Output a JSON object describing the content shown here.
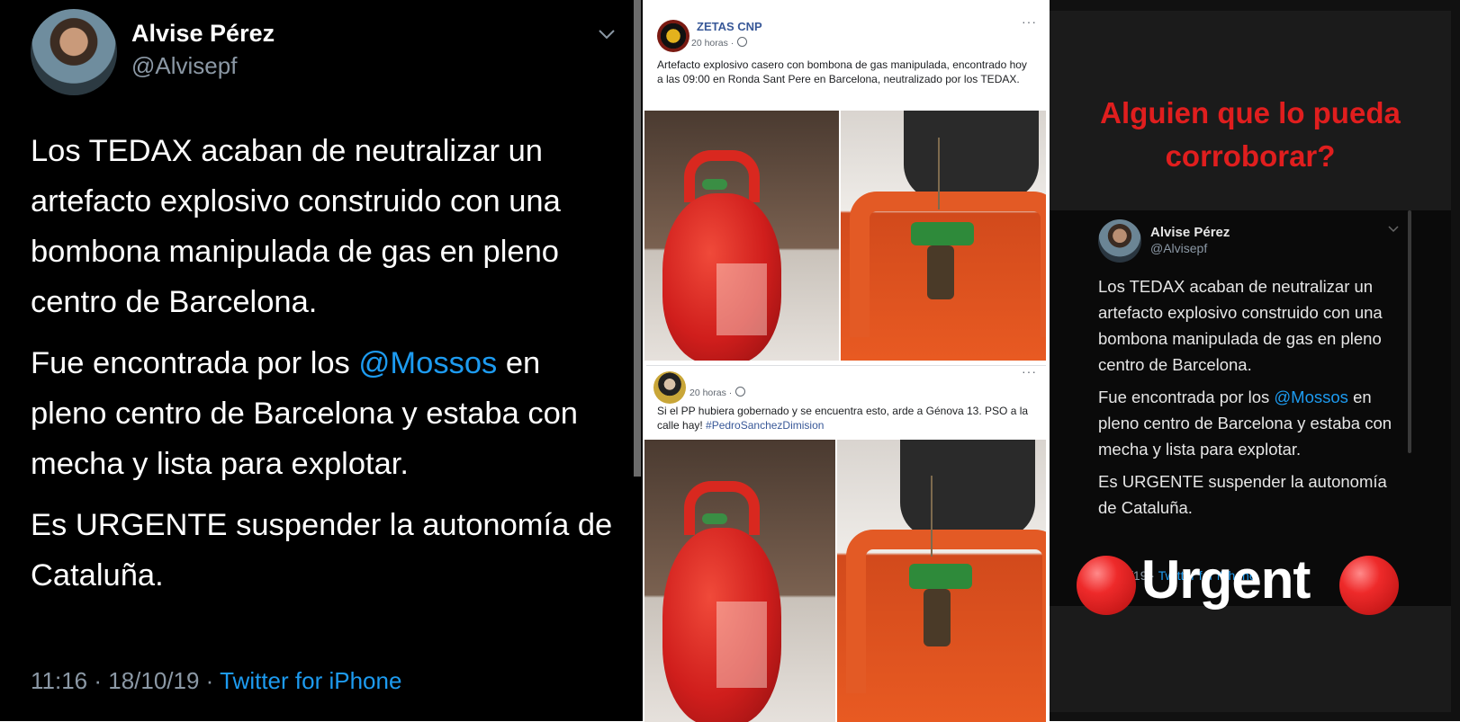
{
  "tweet": {
    "name": "Alvise Pérez",
    "handle": "@Alvisepf",
    "paragraph1": "Los TEDAX acaban de neutralizar un artefacto explosivo construido con una bombona manipulada de gas en pleno centro de Barcelona.",
    "p2_before": "Fue encontrada por los ",
    "p2_mention": "@Mossos",
    "p2_after": " en pleno centro de Barcelona y estaba con mecha y lista para explotar.",
    "paragraph3": "Es URGENTE suspender la autonomía de Cataluña.",
    "timestamp": "11:16 · 18/10/19 · ",
    "source": "Twitter for iPhone",
    "icons": {
      "menu": "chevron-down-icon"
    }
  },
  "facebook": {
    "post1": {
      "page_name": "ZETAS CNP",
      "time": "20 horas ·",
      "menu": "···",
      "text": "Artefacto explosivo casero con bombona de gas manipulada, encontrado hoy a las 09:00 en Ronda Sant Pere en Barcelona, neutralizado por los TEDAX."
    },
    "post2": {
      "time": "20 horas ·",
      "menu": "···",
      "text": "Si el PP hubiera gobernado y se encuentra esto, arde a Génova 13. PSO a la calle hay! ",
      "hashtag": "#PedroSanchezDimision"
    },
    "colors": {
      "link": "#385898",
      "cylinder": "#d01e1c",
      "valve": "#2e8a3a"
    }
  },
  "story": {
    "headline_line1": "Alguien que lo pueda",
    "headline_line2": "corroborar?",
    "name": "Alvise Pérez",
    "handle": "@Alvisepf",
    "paragraph1": "Los TEDAX acaban de neutralizar un artefacto explosivo construido con una bombona manipulada de gas en pleno centro de Barcelona.",
    "p2_before": "Fue encontrada por los ",
    "p2_mention": "@Mossos",
    "p2_after": " en pleno centro de Barcelona y estaba con mecha y lista para explotar.",
    "paragraph3": "Es URGENTE suspender la autonomía de Cataluña.",
    "meta_partial": "18/10/19 · ",
    "meta_source": "Twitter for iPhone",
    "urgent": "Urgent",
    "colors": {
      "headline": "#e01e1e",
      "dot": "#ee2a2a"
    }
  }
}
